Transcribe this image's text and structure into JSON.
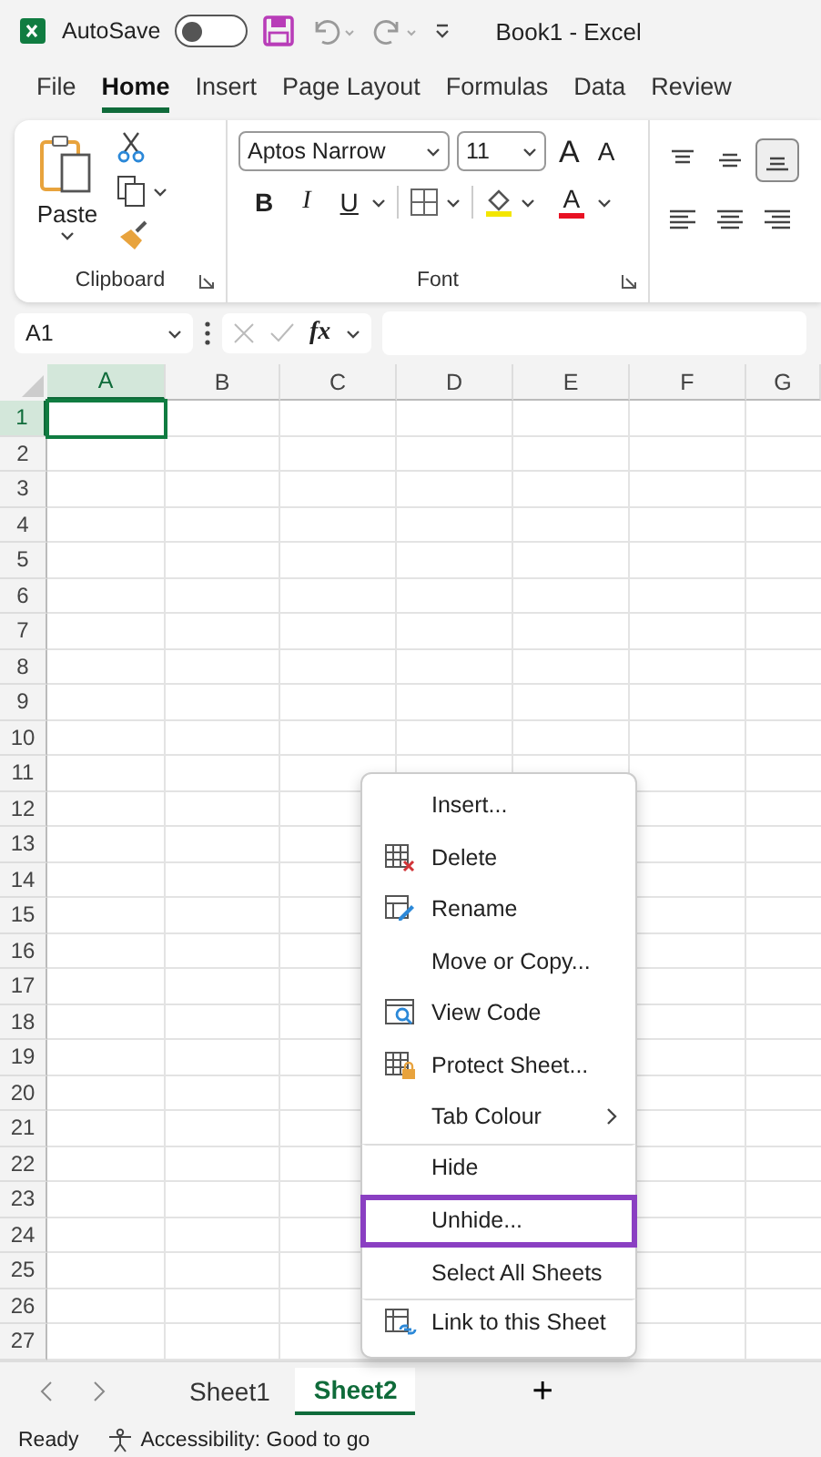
{
  "title_bar": {
    "autosave_label": "AutoSave",
    "autosave_on": false,
    "title": "Book1  -  Excel"
  },
  "ribbon_tabs": [
    {
      "label": "File",
      "selected": false
    },
    {
      "label": "Home",
      "selected": true
    },
    {
      "label": "Insert",
      "selected": false
    },
    {
      "label": "Page Layout",
      "selected": false
    },
    {
      "label": "Formulas",
      "selected": false
    },
    {
      "label": "Data",
      "selected": false
    },
    {
      "label": "Review",
      "selected": false
    }
  ],
  "clipboard": {
    "paste_label": "Paste",
    "group_label": "Clipboard"
  },
  "font": {
    "name": "Aptos Narrow",
    "size": "11",
    "grow": "A",
    "shrink": "A",
    "bold": "B",
    "italic": "I",
    "underline": "U",
    "font_color": "A",
    "group_label": "Font"
  },
  "alignment": [
    {
      "kind": "top",
      "selected": false
    },
    {
      "kind": "middle",
      "selected": false
    },
    {
      "kind": "bottom",
      "selected": true
    },
    {
      "kind": "left",
      "selected": false
    },
    {
      "kind": "center",
      "selected": false
    },
    {
      "kind": "right",
      "selected": false
    }
  ],
  "formula_bar": {
    "name_box": "A1",
    "fx": "fx"
  },
  "columns": [
    {
      "label": "A",
      "selected": true
    },
    {
      "label": "B",
      "selected": false
    },
    {
      "label": "C",
      "selected": false
    },
    {
      "label": "D",
      "selected": false
    },
    {
      "label": "E",
      "selected": false
    },
    {
      "label": "F",
      "selected": false
    },
    {
      "label": "G",
      "selected": false
    }
  ],
  "rows": [
    {
      "label": "1",
      "selected": true
    },
    {
      "label": "2",
      "selected": false
    },
    {
      "label": "3",
      "selected": false
    },
    {
      "label": "4",
      "selected": false
    },
    {
      "label": "5",
      "selected": false
    },
    {
      "label": "6",
      "selected": false
    },
    {
      "label": "7",
      "selected": false
    },
    {
      "label": "8",
      "selected": false
    },
    {
      "label": "9",
      "selected": false
    },
    {
      "label": "10",
      "selected": false
    },
    {
      "label": "11",
      "selected": false
    },
    {
      "label": "12",
      "selected": false
    },
    {
      "label": "13",
      "selected": false
    },
    {
      "label": "14",
      "selected": false
    },
    {
      "label": "15",
      "selected": false
    },
    {
      "label": "16",
      "selected": false
    },
    {
      "label": "17",
      "selected": false
    },
    {
      "label": "18",
      "selected": false
    },
    {
      "label": "19",
      "selected": false
    },
    {
      "label": "20",
      "selected": false
    },
    {
      "label": "21",
      "selected": false
    },
    {
      "label": "22",
      "selected": false
    },
    {
      "label": "23",
      "selected": false
    },
    {
      "label": "24",
      "selected": false
    },
    {
      "label": "25",
      "selected": false
    },
    {
      "label": "26",
      "selected": false
    },
    {
      "label": "27",
      "selected": false
    }
  ],
  "context_menu": [
    {
      "label": "Insert...",
      "kind": "plain",
      "selected": false,
      "group_start": false,
      "submenu": false
    },
    {
      "label": "Delete",
      "kind": "delete",
      "selected": false,
      "group_start": false,
      "submenu": false
    },
    {
      "label": "Rename",
      "kind": "rename",
      "selected": false,
      "group_start": false,
      "submenu": false
    },
    {
      "label": "Move or Copy...",
      "kind": "plain",
      "selected": false,
      "group_start": false,
      "submenu": false
    },
    {
      "label": "View Code",
      "kind": "view_code",
      "selected": false,
      "group_start": false,
      "submenu": false
    },
    {
      "label": "Protect Sheet...",
      "kind": "protect",
      "selected": false,
      "group_start": false,
      "submenu": false
    },
    {
      "label": "Tab Colour",
      "kind": "plain",
      "selected": false,
      "group_start": false,
      "submenu": true
    },
    {
      "label": "Hide",
      "kind": "plain",
      "selected": false,
      "group_start": true,
      "submenu": false
    },
    {
      "label": "Unhide...",
      "kind": "plain",
      "selected": true,
      "group_start": false,
      "submenu": false
    },
    {
      "label": "Select All Sheets",
      "kind": "plain",
      "selected": false,
      "group_start": false,
      "submenu": false
    },
    {
      "label": "Link to this Sheet",
      "kind": "link",
      "selected": false,
      "group_start": true,
      "submenu": false
    }
  ],
  "sheet_tabs": [
    {
      "label": "Sheet1",
      "selected": false
    },
    {
      "label": "Sheet2",
      "selected": true
    }
  ],
  "add_sheet": "+",
  "status_bar": {
    "ready": "Ready",
    "accessibility": "Accessibility: Good to go"
  }
}
